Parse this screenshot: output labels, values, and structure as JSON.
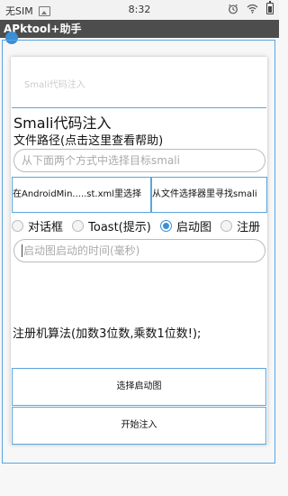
{
  "status_bar": {
    "carrier": "无SIM",
    "time": "8:32",
    "icons": [
      "image-icon",
      "alarm-icon",
      "wifi-icon",
      "battery-icon"
    ]
  },
  "app_bar": {
    "title": "APktool+助手"
  },
  "dialog": {
    "ghost_title": "Smali代码注入",
    "section_title": "Smali代码注入",
    "path_label": "文件路径(点击这里查看帮助)",
    "path_input": {
      "placeholder": "从下面两个方式中选择目标smali",
      "value": ""
    },
    "select_from_manifest": "在AndroidMin.....st.xml里选择",
    "select_from_file": "从文件选择器里寻找smali",
    "radio_options": [
      {
        "label": "对话框",
        "checked": false
      },
      {
        "label": "Toast(提示)",
        "checked": false
      },
      {
        "label": "启动图",
        "checked": true
      },
      {
        "label": "注册",
        "checked": false
      }
    ],
    "time_input": {
      "placeholder": "启动图启动的时间(毫秒)",
      "value": ""
    },
    "keygen_text": "注册机算法(加数3位数,乘数1位数!);",
    "select_image_button": "选择启动图",
    "start_inject_button": "开始注入"
  },
  "colors": {
    "accent": "#5aa6de",
    "app_bar": "#4d4d4d",
    "radio_checked": "#3a8fd6"
  }
}
